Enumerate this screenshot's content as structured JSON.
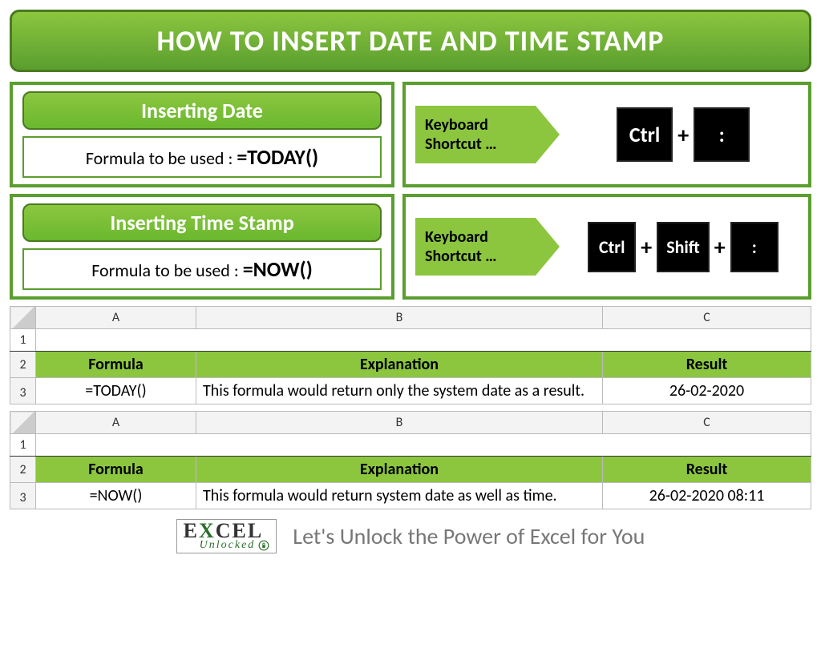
{
  "title": "HOW TO INSERT DATE AND TIME STAMP",
  "section1": {
    "header": "Inserting Date",
    "formula_label": "Formula to be used : ",
    "formula": "=TODAY()",
    "shortcut_label": "Keyboard Shortcut …",
    "keys": [
      "Ctrl",
      ":"
    ]
  },
  "section2": {
    "header": "Inserting Time Stamp",
    "formula_label": "Formula to be used : ",
    "formula": "=NOW()",
    "shortcut_label": "Keyboard Shortcut …",
    "keys": [
      "Ctrl",
      "Shift",
      ":"
    ]
  },
  "columns": [
    "A",
    "B",
    "C"
  ],
  "table_headers": [
    "Formula",
    "Explanation",
    "Result"
  ],
  "table1": {
    "formula": "=TODAY()",
    "explanation": "This formula would return only the system date as a result.",
    "result": "26-02-2020"
  },
  "table2": {
    "formula": "=NOW()",
    "explanation": "This formula would return system date as well as time.",
    "result": "26-02-2020 08:11"
  },
  "footer": {
    "brand_top": "EXCEL",
    "brand_bot": "Unlocked",
    "tagline": "Let's Unlock the Power of Excel for You"
  }
}
